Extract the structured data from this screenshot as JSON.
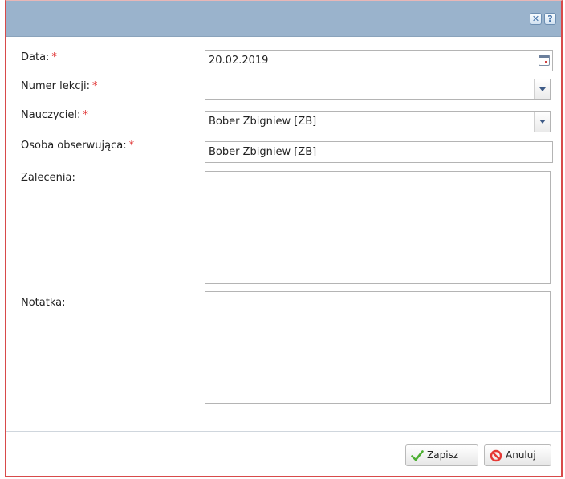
{
  "titlebar": {
    "close_icon": "close-icon",
    "help_icon": "help-icon",
    "close_glyph": "✕",
    "help_glyph": "?"
  },
  "form": {
    "date": {
      "label": "Data:",
      "required_mark": "*",
      "value": "20.02.2019",
      "icon": "calendar-icon"
    },
    "lesson_number": {
      "label": "Numer lekcji:",
      "required_mark": "*",
      "value": "",
      "icon": "chevron-down-icon"
    },
    "teacher": {
      "label": "Nauczyciel:",
      "required_mark": "*",
      "value": "Bober Zbigniew [ZB]",
      "icon": "chevron-down-icon"
    },
    "observer": {
      "label": "Osoba obserwująca:",
      "required_mark": "*",
      "value": "Bober Zbigniew [ZB]"
    },
    "recommendations": {
      "label": "Zalecenia:",
      "value": ""
    },
    "note": {
      "label": "Notatka:",
      "value": ""
    }
  },
  "footer": {
    "save_label": "Zapisz",
    "cancel_label": "Anuluj",
    "save_icon": "checkmark-icon",
    "cancel_icon": "cancel-icon",
    "save_icon_color": "#4caf32",
    "cancel_icon_color": "#e53935"
  },
  "colors": {
    "titlebar": "#9ab3cc",
    "border_accent": "#d84a4a",
    "required": "#e03030"
  }
}
